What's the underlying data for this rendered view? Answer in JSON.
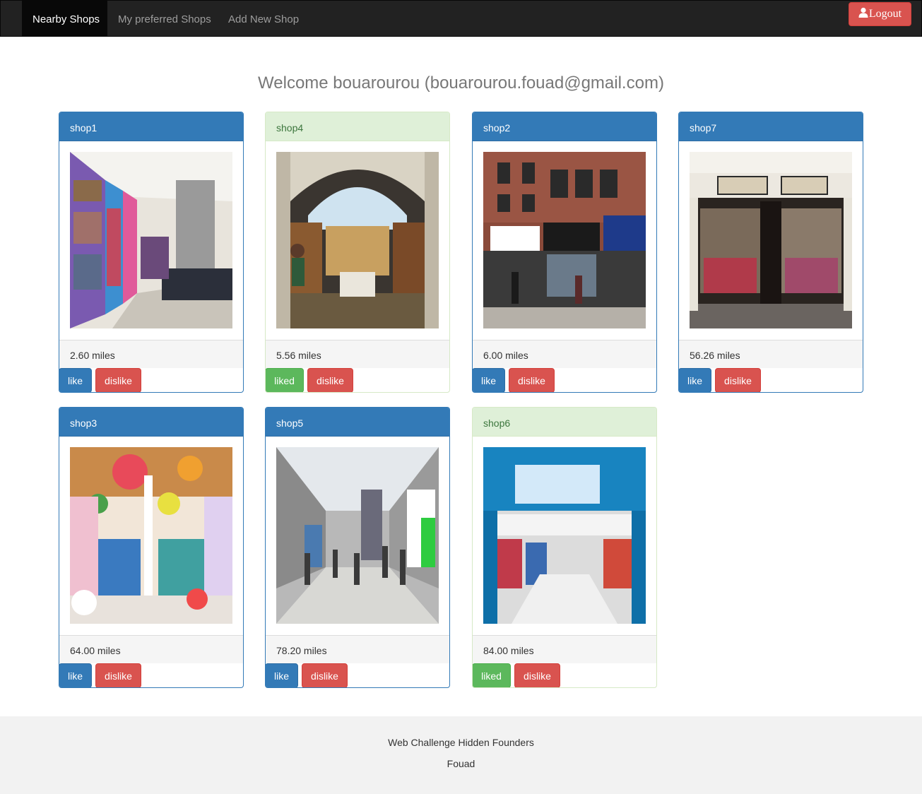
{
  "nav": {
    "items": [
      {
        "label": "Nearby Shops",
        "active": true
      },
      {
        "label": "My preferred Shops",
        "active": false
      },
      {
        "label": "Add New Shop",
        "active": false
      }
    ],
    "logout_label": "Logout"
  },
  "welcome": "Welcome bouarourou (bouarourou.fouad@gmail.com)",
  "shops": [
    {
      "name": "shop1",
      "distance": "2.60 miles",
      "liked": false,
      "like_label": "like",
      "dislike_label": "dislike",
      "image": "clothing store interior"
    },
    {
      "name": "shop4",
      "distance": "5.56 miles",
      "liked": true,
      "like_label": "liked",
      "dislike_label": "dislike",
      "image": "bookstore interior"
    },
    {
      "name": "shop2",
      "distance": "6.00 miles",
      "liked": false,
      "like_label": "like",
      "dislike_label": "dislike",
      "image": "Broadway street storefront"
    },
    {
      "name": "shop7",
      "distance": "56.26 miles",
      "liked": false,
      "like_label": "like",
      "dislike_label": "dislike",
      "image": "Urban Fox vintage storefront"
    },
    {
      "name": "shop3",
      "distance": "64.00 miles",
      "liked": false,
      "like_label": "like",
      "dislike_label": "dislike",
      "image": "candy store interior"
    },
    {
      "name": "shop5",
      "distance": "78.20 miles",
      "liked": false,
      "like_label": "like",
      "dislike_label": "dislike",
      "image": "shopping mall hallway"
    },
    {
      "name": "shop6",
      "distance": "84.00 miles",
      "liked": true,
      "like_label": "liked",
      "dislike_label": "dislike",
      "image": "Big W store entrance"
    }
  ],
  "footer": {
    "line1": "Web Challenge Hidden Founders",
    "line2": "Fouad"
  },
  "colors": {
    "navbar": "#222222",
    "primary": "#337ab7",
    "success": "#5cb85c",
    "danger": "#d9534f",
    "liked_header": "#dff0d8"
  }
}
